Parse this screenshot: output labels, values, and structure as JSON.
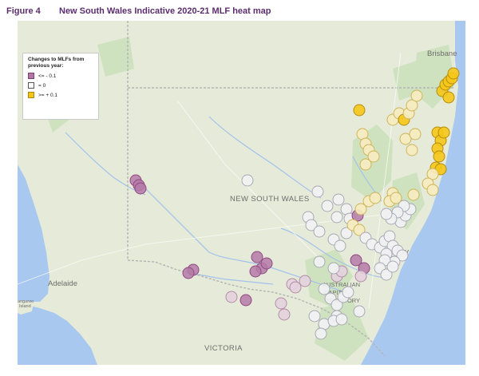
{
  "figure": {
    "number": "Figure 4",
    "title": "New South Wales Indicative 2020-21 MLF heat map"
  },
  "legend": {
    "title": "Changes to MLFs from previous year:",
    "items": [
      {
        "label": "<= - 0.1",
        "color": "#b177a4",
        "border": "#7d3f6f"
      },
      {
        "label": "= 0",
        "color": "#ffffff",
        "border": "#555555"
      },
      {
        "label": ">= + 0.1",
        "color": "#f3c515",
        "border": "#a7860a"
      }
    ]
  },
  "map_labels": {
    "nsw": "NEW SOUTH WALES",
    "victoria": "VICTORIA",
    "brisbane": "Brisbane",
    "adelaide": "Adelaide",
    "sydney_fragment": "ey",
    "kangaroo_island": "angaroo\nIsland",
    "act_line1": "AUSTRALIAN",
    "act_line2": "CAPITAL",
    "act_line3": "TERRITORY"
  },
  "colors": {
    "land": "#e6ead8",
    "ocean": "#a9c8f0",
    "forest": "#cfe2bf",
    "border": "#b4b4b4",
    "river": "#a2c2ec",
    "purple": "#b57aa8",
    "purple_dark": "#8e4a82",
    "white": "#f2f2f5",
    "yellow": "#f5c71a",
    "light_yellow": "#f7ecc0",
    "light_purple": "#e3d3de"
  }
}
